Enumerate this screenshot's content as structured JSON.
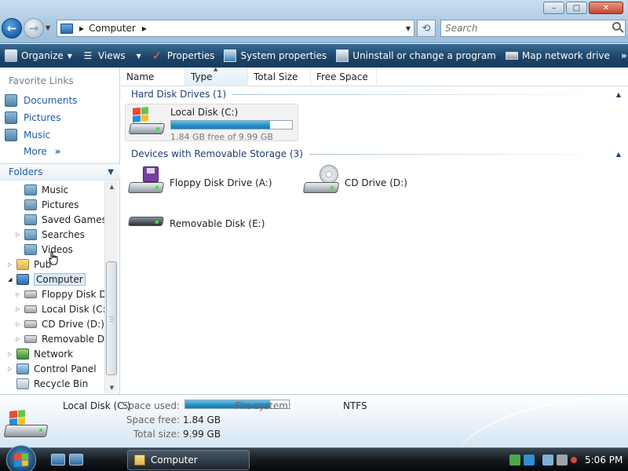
{
  "window": {
    "controls": {
      "minimize": "–",
      "maximize": "□",
      "close": "✕"
    }
  },
  "nav": {
    "back_icon": "←",
    "forward_icon": "→",
    "address": {
      "crumb": "Computer"
    },
    "search": {
      "placeholder": "Search"
    }
  },
  "toolbar": {
    "organize": "Organize",
    "views": "Views",
    "properties": "Properties",
    "system_properties": "System properties",
    "uninstall": "Uninstall or change a program",
    "map_drive": "Map network drive",
    "more": "»"
  },
  "sidebar": {
    "favorite_links_title": "Favorite Links",
    "favorites": [
      "Documents",
      "Pictures",
      "Music"
    ],
    "more": "More",
    "folders_title": "Folders",
    "tree": [
      {
        "label": "Music",
        "icon": "library"
      },
      {
        "label": "Pictures",
        "icon": "library"
      },
      {
        "label": "Saved Games",
        "icon": "library"
      },
      {
        "label": "Searches",
        "icon": "library"
      },
      {
        "label": "Videos",
        "icon": "library"
      },
      {
        "label": "Pub",
        "icon": "folder"
      },
      {
        "label": "Computer",
        "icon": "computer"
      },
      {
        "label": "Floppy Disk Driv",
        "icon": "floppy-drive"
      },
      {
        "label": "Local Disk (C:)",
        "icon": "hard-disk"
      },
      {
        "label": "CD Drive (D:)",
        "icon": "cd-drive"
      },
      {
        "label": "Removable Disk",
        "icon": "removable-disk"
      },
      {
        "label": "Network",
        "icon": "network"
      },
      {
        "label": "Control Panel",
        "icon": "control-panel"
      },
      {
        "label": "Recycle Bin",
        "icon": "recycle-bin"
      }
    ]
  },
  "main": {
    "columns": [
      "Name",
      "Type",
      "Total Size",
      "Free Space"
    ],
    "groups": {
      "hard_disks": {
        "title": "Hard Disk Drives (1)",
        "items": [
          {
            "name": "Local Disk (C:)",
            "free_text": "1.84 GB free of 9.99 GB",
            "used_fraction": 0.816
          }
        ]
      },
      "removable": {
        "title": "Devices with Removable Storage (3)",
        "items": [
          {
            "name": "Floppy Disk Drive (A:)"
          },
          {
            "name": "CD Drive (D:)"
          },
          {
            "name": "Removable Disk (E:)"
          }
        ]
      }
    }
  },
  "details": {
    "name": "Local Disk (C:)",
    "space_used_label": "Space used:",
    "space_used_fraction": 0.816,
    "file_system_label": "File system:",
    "file_system": "NTFS",
    "space_free_label": "Space free:",
    "space_free": "1.84 GB",
    "total_size_label": "Total size:",
    "total_size": "9.99 GB"
  },
  "taskbar": {
    "task": "Computer",
    "time": "5:06 PM"
  },
  "colors": {
    "link": "#1c5ca8",
    "group_header": "#1c3e73",
    "command_bar": "#1d4569",
    "capacity_fill": "#2590c6"
  }
}
